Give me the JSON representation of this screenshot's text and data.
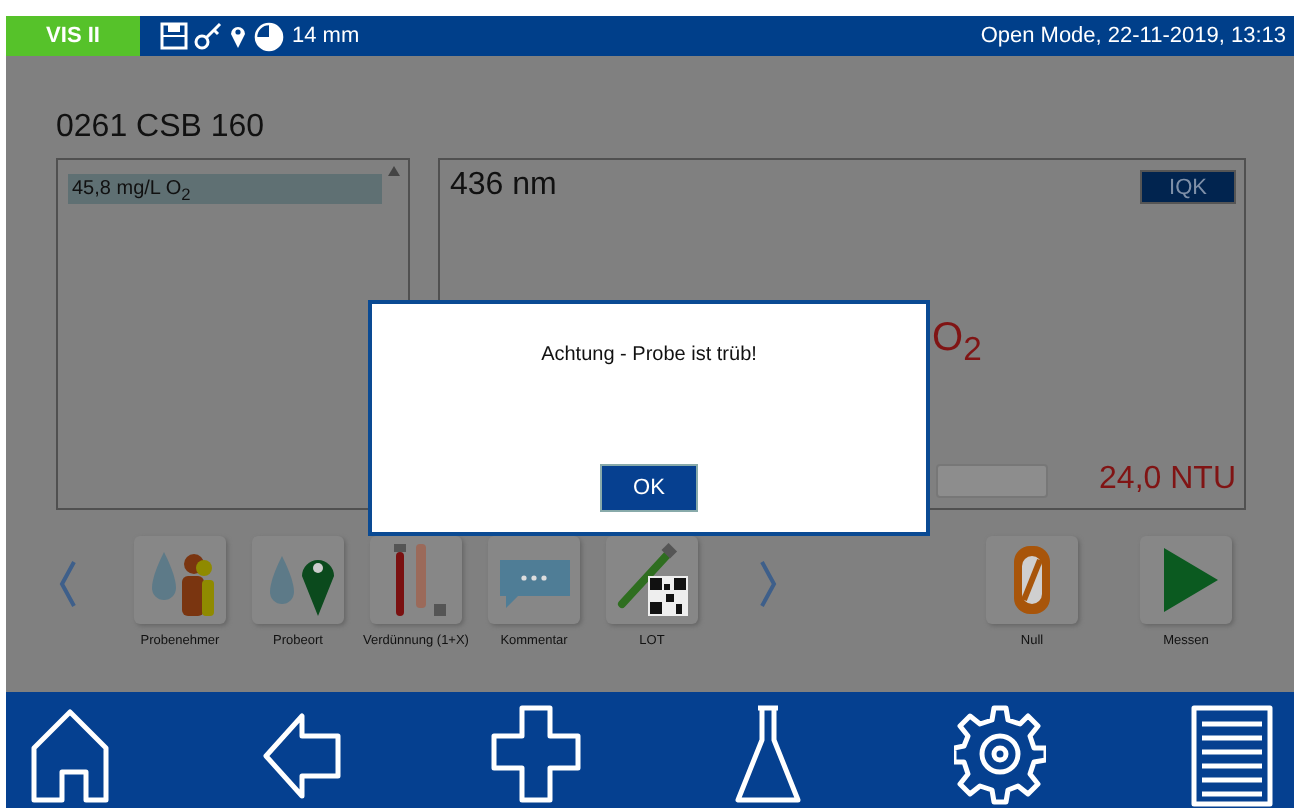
{
  "status_bar": {
    "instrument": "VIS II",
    "path_length": "14 mm",
    "mode_datetime": "Open Mode, 22-11-2019, 13:13"
  },
  "method": {
    "title": "0261 CSB 160"
  },
  "results_list": {
    "items": [
      {
        "text": "45,8 mg/L O$_{2}$",
        "selected": true
      }
    ]
  },
  "measurement": {
    "wavelength": "436 nm",
    "iqk_button": "IQK",
    "result_unit": "O$_{2}$",
    "turbidity": "24,0 NTU"
  },
  "toolbar": {
    "items": [
      {
        "label": "Probenehmer",
        "kind": "sampler"
      },
      {
        "label": "Probeort",
        "kind": "location"
      },
      {
        "label": "Verdünnung (1+X)",
        "kind": "dilution"
      },
      {
        "label": "Kommentar",
        "kind": "comment"
      },
      {
        "label": "LOT",
        "kind": "lot"
      }
    ]
  },
  "actions": [
    {
      "label": "Null",
      "kind": "zero"
    },
    {
      "label": "Messen",
      "kind": "measure"
    }
  ],
  "dialog": {
    "message": "Achtung - Probe ist trüb!",
    "buttons": [
      "OK"
    ]
  }
}
